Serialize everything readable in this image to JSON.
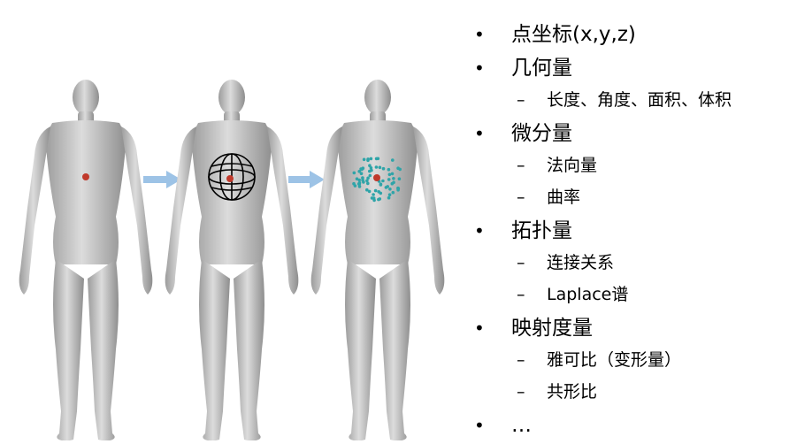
{
  "colors": {
    "body_fill": "#c9c9c9",
    "arrow": "#9dc3e6",
    "point": "#c0392b",
    "neighbor": "#2fa4a8",
    "grid_line": "#000000"
  },
  "bullets": [
    {
      "marker": "•",
      "text": "点坐标(x,y,z)",
      "subs": []
    },
    {
      "marker": "•",
      "text": "几何量",
      "subs": [
        "长度、角度、面积、体积"
      ]
    },
    {
      "marker": "•",
      "text": "微分量",
      "subs": [
        "法向量",
        "曲率"
      ]
    },
    {
      "marker": "•",
      "text": "拓扑量",
      "subs": [
        "连接关系",
        "Laplace谱"
      ]
    },
    {
      "marker": "•",
      "text": "映射度量",
      "subs": [
        "雅可比（变形量）",
        "共形比"
      ]
    },
    {
      "marker": "•",
      "text": "…",
      "subs": []
    }
  ],
  "sub_marker": "–"
}
